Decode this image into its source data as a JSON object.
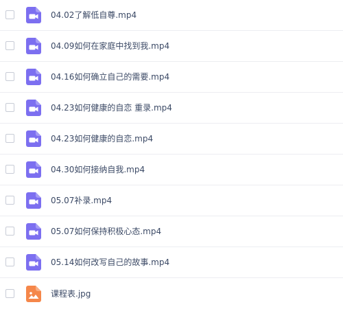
{
  "colors": {
    "video_icon": "#7c6ff0",
    "image_icon": "#f5874a",
    "divider": "#ecedf1",
    "text": "#3c4a66"
  },
  "files": [
    {
      "name": "04.02了解低自尊.mp4",
      "icon": "video-file-icon"
    },
    {
      "name": "04.09如何在家庭中找到我.mp4",
      "icon": "video-file-icon"
    },
    {
      "name": "04.16如何确立自己的需要.mp4",
      "icon": "video-file-icon"
    },
    {
      "name": "04.23如何健康的自恋 重录.mp4",
      "icon": "video-file-icon"
    },
    {
      "name": "04.23如何健康的自恋.mp4",
      "icon": "video-file-icon"
    },
    {
      "name": "04.30如何接纳自我.mp4",
      "icon": "video-file-icon"
    },
    {
      "name": "05.07补录.mp4",
      "icon": "video-file-icon"
    },
    {
      "name": "05.07如何保持积极心态.mp4",
      "icon": "video-file-icon"
    },
    {
      "name": "05.14如何改写自己的故事.mp4",
      "icon": "video-file-icon"
    },
    {
      "name": "课程表.jpg",
      "icon": "image-file-icon"
    }
  ]
}
